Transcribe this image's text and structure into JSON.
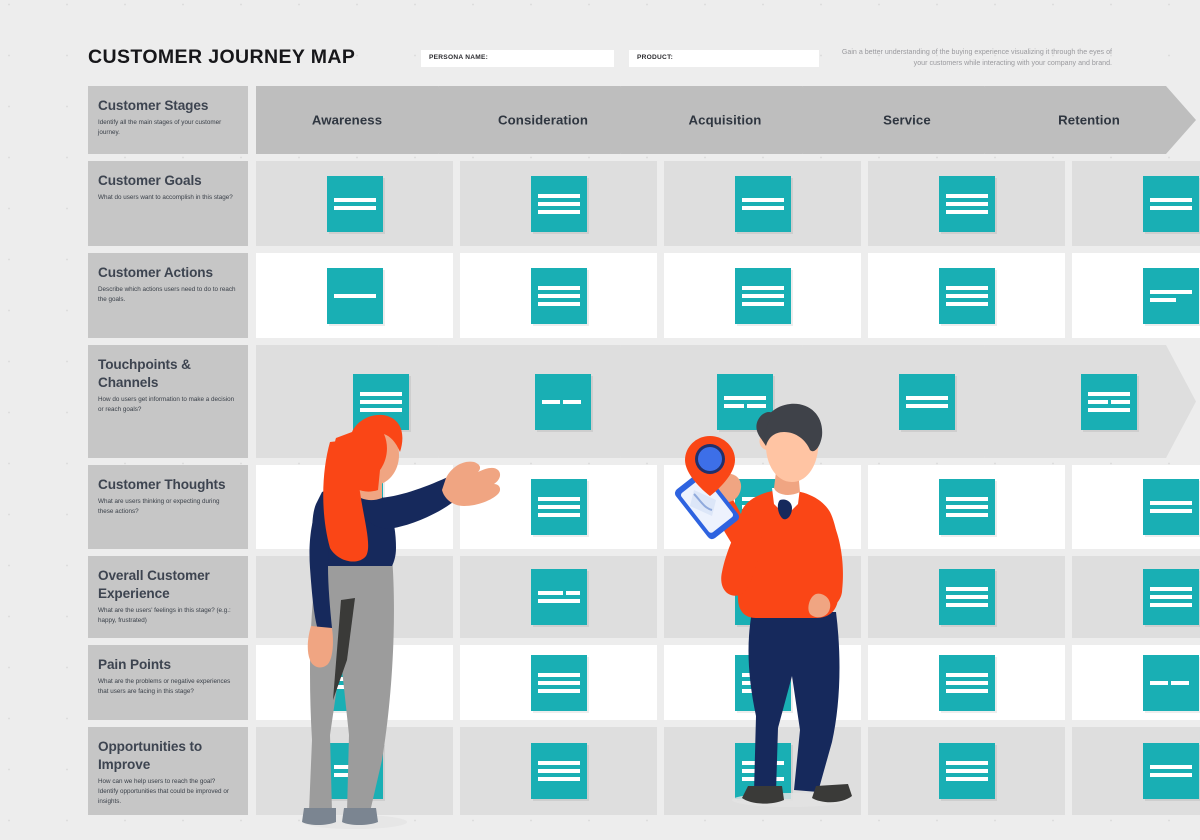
{
  "header": {
    "title": "CUSTOMER JOURNEY MAP",
    "persona_label": "PERSONA NAME:",
    "persona_value": "",
    "product_label": "PRODUCT:",
    "product_value": "",
    "description": "Gain a better understanding of the buying experience visualizing it through the eyes of your customers while interacting with your company and brand."
  },
  "colors": {
    "page_background": "#EDEDED",
    "label_cell": "#C6C6C6",
    "stage_chevron": "#BEBEBE",
    "row_gray": "#DEDEDE",
    "row_white": "#FFFFFF",
    "note_teal": "#19AFB4",
    "heading_text": "#3D4450",
    "accent_orange": "#FA4616",
    "accent_navy": "#16295C",
    "accent_blue": "#3D6FE8"
  },
  "stages": [
    {
      "label": "Awareness"
    },
    {
      "label": "Consideration"
    },
    {
      "label": "Acquisition"
    },
    {
      "label": "Service"
    },
    {
      "label": "Retention"
    }
  ],
  "rows": [
    {
      "title": "Customer Stages",
      "description": "Identify all the main stages of your customer journey.",
      "style": "chevron-header",
      "height": 68,
      "notes": []
    },
    {
      "title": "Customer Goals",
      "description": "What do users want to accomplish in this stage?",
      "style": "gray",
      "height": 85,
      "notes": [
        {
          "lines": [
            [
              46
            ],
            [
              46
            ]
          ]
        },
        {
          "lines": [
            [
              42
            ],
            [
              42
            ],
            [
              42
            ]
          ]
        },
        {
          "lines": [
            [
              42
            ],
            [
              42
            ]
          ]
        },
        {
          "lines": [
            [
              42
            ],
            [
              42
            ],
            [
              42
            ]
          ]
        },
        {
          "lines": [
            [
              42
            ],
            [
              42
            ]
          ]
        }
      ]
    },
    {
      "title": "Customer Actions",
      "description": "Describe which actions users need to do to reach the goals.",
      "style": "white",
      "height": 85,
      "notes": [
        {
          "lines": [
            [
              42
            ]
          ]
        },
        {
          "lines": [
            [
              42
            ],
            [
              42
            ],
            [
              42
            ]
          ]
        },
        {
          "lines": [
            [
              42
            ],
            [
              42
            ],
            [
              42
            ]
          ]
        },
        {
          "lines": [
            [
              42
            ],
            [
              42
            ],
            [
              42
            ]
          ]
        },
        {
          "lines": [
            [
              42
            ],
            [
              26
            ]
          ]
        }
      ]
    },
    {
      "title": "Touchpoints & Channels",
      "description": "How do users get information to make a decision or reach goals?",
      "style": "chevron-body",
      "height": 113,
      "notes": [
        {
          "lines": [
            [
              42
            ],
            [
              42
            ],
            [
              42
            ]
          ]
        },
        {
          "lines": [
            [
              18,
              18
            ]
          ]
        },
        {
          "lines": [
            [
              42
            ],
            [
              20,
              19
            ]
          ]
        },
        {
          "lines": [
            [
              42
            ],
            [
              42
            ]
          ]
        },
        {
          "lines": [
            [
              42
            ],
            [
              20,
              19
            ],
            [
              42
            ]
          ]
        }
      ]
    },
    {
      "title": "Customer Thoughts",
      "description": "What are users thinking or expecting during these actions?",
      "style": "white",
      "height": 84,
      "notes": [
        {
          "lines": [
            [
              42
            ],
            [
              42
            ]
          ]
        },
        {
          "lines": [
            [
              42
            ],
            [
              42
            ],
            [
              42
            ]
          ]
        },
        {
          "lines": [
            [
              42
            ],
            [
              42
            ],
            [
              42
            ]
          ]
        },
        {
          "lines": [
            [
              42
            ],
            [
              42
            ],
            [
              42
            ]
          ]
        },
        {
          "lines": [
            [
              42
            ],
            [
              42
            ]
          ]
        }
      ]
    },
    {
      "title": "Overall Customer Experience",
      "description": "What are the users'  feelings in this stage? (e.g.: happy, frustrated)",
      "style": "gray",
      "height": 82,
      "notes": [
        {
          "lines": [
            [
              42
            ],
            [
              42
            ]
          ]
        },
        {
          "lines": [
            [
              26,
              14
            ],
            [
              42
            ]
          ]
        },
        {
          "lines": [
            [
              42
            ],
            [
              42
            ]
          ]
        },
        {
          "lines": [
            [
              42
            ],
            [
              42
            ],
            [
              42
            ]
          ]
        },
        {
          "lines": [
            [
              42
            ],
            [
              42
            ],
            [
              42
            ]
          ]
        }
      ]
    },
    {
      "title": "Pain Points",
      "description": "What are the problems or negative experiences that users are facing in this stage?",
      "style": "white",
      "height": 75,
      "notes": [
        {
          "lines": [
            [
              42
            ],
            [
              42
            ]
          ]
        },
        {
          "lines": [
            [
              42
            ],
            [
              42
            ],
            [
              42
            ]
          ]
        },
        {
          "lines": [
            [
              42
            ],
            [
              26
            ],
            [
              42
            ]
          ]
        },
        {
          "lines": [
            [
              42
            ],
            [
              42
            ],
            [
              42
            ]
          ]
        },
        {
          "lines": [
            [
              18,
              18
            ]
          ]
        }
      ]
    },
    {
      "title": "Opportunities to Improve",
      "description": "How can we help users to reach the goal? Identify opportunities that could be improved or insights.",
      "style": "gray",
      "height": 88,
      "notes": [
        {
          "lines": [
            [
              42
            ],
            [
              42
            ]
          ]
        },
        {
          "lines": [
            [
              42
            ],
            [
              42
            ],
            [
              42
            ]
          ]
        },
        {
          "lines": [
            [
              42
            ],
            [
              26
            ],
            [
              42
            ]
          ]
        },
        {
          "lines": [
            [
              42
            ],
            [
              42
            ],
            [
              42
            ]
          ]
        },
        {
          "lines": [
            [
              42
            ],
            [
              42
            ]
          ]
        }
      ]
    }
  ],
  "illustration": {
    "figures": [
      {
        "name": "woman-pointing",
        "hair_color": "#FA4616",
        "top_color": "#16295C",
        "pants_color": "#9C9C9C"
      },
      {
        "name": "man-with-phone",
        "hair_color": "#3F4249",
        "top_color": "#FA4616",
        "pants_color": "#16295C"
      }
    ],
    "props": [
      "location-pin-icon",
      "smartphone-map-icon"
    ]
  }
}
